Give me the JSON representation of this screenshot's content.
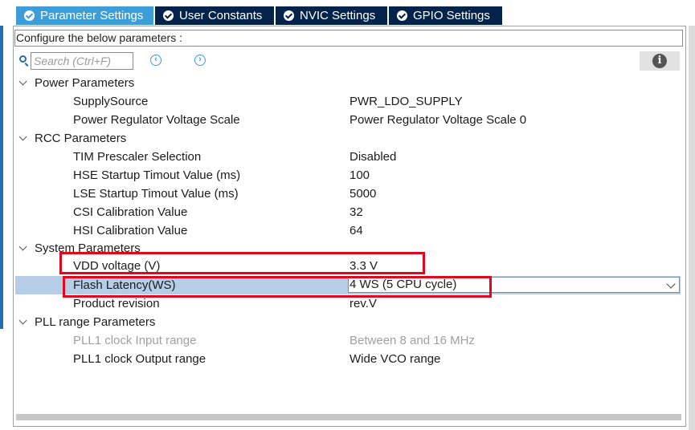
{
  "tabs": [
    {
      "label": "Parameter Settings",
      "active": true
    },
    {
      "label": "User Constants"
    },
    {
      "label": "NVIC Settings"
    },
    {
      "label": "GPIO Settings"
    }
  ],
  "configure_label": "Configure the below parameters :",
  "search": {
    "placeholder": "Search (Ctrl+F)"
  },
  "nav": {
    "prev": "‹",
    "next": "›"
  },
  "info": "i",
  "groups": {
    "power": {
      "label": "Power Parameters",
      "items": [
        {
          "label": "SupplySource",
          "value": "PWR_LDO_SUPPLY"
        },
        {
          "label": "Power Regulator Voltage Scale",
          "value": "Power Regulator Voltage Scale 0"
        }
      ]
    },
    "rcc": {
      "label": "RCC Parameters",
      "items": [
        {
          "label": "TIM Prescaler Selection",
          "value": "Disabled"
        },
        {
          "label": "HSE Startup Timout Value (ms)",
          "value": "100"
        },
        {
          "label": "LSE Startup Timout Value (ms)",
          "value": "5000"
        },
        {
          "label": "CSI Calibration Value",
          "value": "32"
        },
        {
          "label": "HSI Calibration Value",
          "value": "64"
        }
      ]
    },
    "system": {
      "label": "System Parameters",
      "items": [
        {
          "label": "VDD voltage (V)",
          "value": "3.3 V"
        },
        {
          "label": "Flash Latency(WS)",
          "value": "4 WS (5 CPU cycle)"
        },
        {
          "label": "Product revision",
          "value": "rev.V"
        }
      ]
    },
    "pll": {
      "label": "PLL range Parameters",
      "items": [
        {
          "label": "PLL1 clock Input range",
          "value": "Between 8 and 16 MHz"
        },
        {
          "label": "PLL1 clock Output range",
          "value": "Wide VCO range"
        }
      ]
    }
  },
  "colors": {
    "tab_active": "#3c9ed8",
    "tab_inactive": "#03234b",
    "selection": "#b5cde6",
    "highlight_box": "#e3061d"
  }
}
